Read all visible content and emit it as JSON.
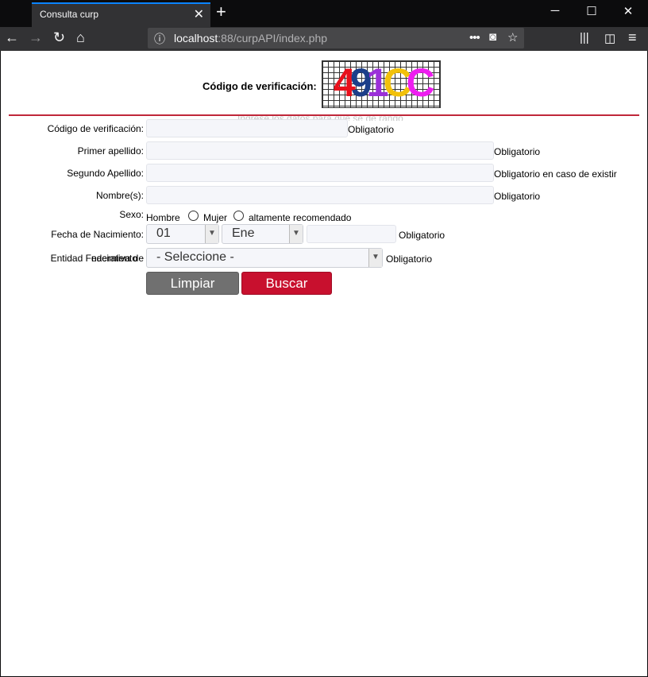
{
  "browser": {
    "tab_title": "Consulta curp",
    "tab_close": "✕",
    "new_tab": "+",
    "window": {
      "minimize": "─",
      "maximize": "☐",
      "close": "✕"
    },
    "url_host": "localhost",
    "url_rest": ":88/curpAPI/index.php",
    "url_actions": "•••"
  },
  "captcha": {
    "label": "Código de verificación:",
    "chars": [
      "4",
      "9",
      "1",
      "C",
      "C"
    ],
    "char_colors": [
      "#e8111c",
      "#1c3f8a",
      "#9b30d9",
      "#f2c10a",
      "#ee1df0"
    ],
    "overflow_text": "Ingrese los datos para que se dé rango"
  },
  "form": {
    "codigo": {
      "label": "Código de verificación:",
      "value": "",
      "note": "Obligatorio"
    },
    "primer_apellido": {
      "label": "Primer apellido:",
      "value": "",
      "note": "Obligatorio"
    },
    "segundo_apellido": {
      "label": "Segundo Apellido:",
      "value": "",
      "note": "Obligatorio en caso de existir"
    },
    "nombres": {
      "label": "Nombre(s):",
      "value": "",
      "note": "Obligatorio"
    },
    "sexo": {
      "label": "Sexo:",
      "hombre": "Hombre",
      "mujer": "Mujer",
      "note": "altamente recomendado"
    },
    "fecha": {
      "label": "Fecha de Nacimiento:",
      "dia": "01",
      "mes": "Ene",
      "anio": "",
      "note": "Obligatorio"
    },
    "entidad": {
      "label": "Entidad Federativa de",
      "label_overlap": "nacimiento",
      "selected": "- Seleccione -",
      "note": "Obligatorio"
    },
    "limpiar": "Limpiar",
    "buscar": "Buscar"
  },
  "colors": {
    "accent_red": "#c8102e",
    "button_gray": "#707070",
    "divider": "#c0273a"
  }
}
